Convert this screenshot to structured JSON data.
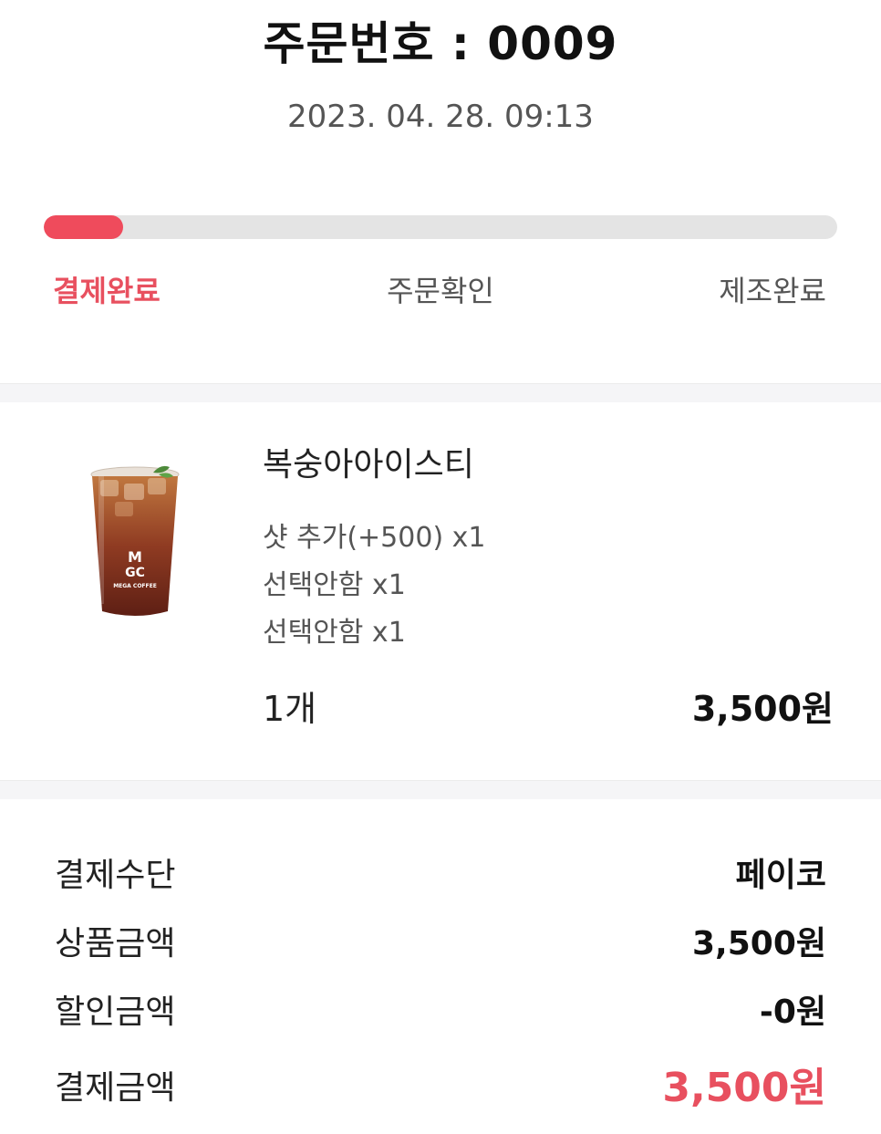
{
  "header": {
    "order_label": "주문번호 : 0009",
    "datetime": "2023. 04. 28. 09:13"
  },
  "progress": {
    "fill_fraction": 0.1,
    "steps": [
      {
        "label": "결제완료",
        "active": true
      },
      {
        "label": "주문확인",
        "active": false
      },
      {
        "label": "제조완료",
        "active": false
      }
    ]
  },
  "item": {
    "name": "복숭아아이스티",
    "options": [
      "샷 추가(+500) x1",
      "선택안함 x1",
      "선택안함 x1"
    ],
    "quantity": "1개",
    "price": "3,500원",
    "cup_brand": {
      "line1": "M",
      "line2": "GC",
      "text": "MEGA COFFEE"
    }
  },
  "summary": {
    "payment_method_label": "결제수단",
    "payment_method_value": "페이코",
    "product_amount_label": "상품금액",
    "product_amount_value": "3,500원",
    "discount_label": "할인금액",
    "discount_value": "-0원",
    "total_label": "결제금액",
    "total_value": "3,500원"
  },
  "colors": {
    "accent": "#e8505f",
    "track": "#e4e4e4",
    "section_bg": "#f5f5f7"
  }
}
